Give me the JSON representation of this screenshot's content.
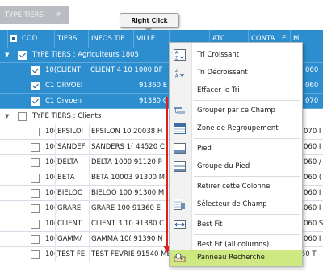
{
  "group_panel": {
    "chip_label": "TYPE TIERS",
    "filter_icon": "filter-icon"
  },
  "tooltip": {
    "label": "Right Click"
  },
  "columns": [
    "COD",
    "TIERS",
    "INFOS.TIE",
    "VILLE",
    "",
    "ATC",
    "CONTA",
    "EL",
    "M"
  ],
  "groups": [
    {
      "title": "TYPE TIERS : Agriculteurs 1805",
      "selected": true,
      "rows": [
        {
          "cod": "10(",
          "tiers": "CLIENT",
          "infos": "CLIENT 4 10 1000 BF",
          "tail": "060"
        },
        {
          "cod": "C1",
          "tiers": "ORVOEI",
          "infos": "91360 E",
          "tail": "060"
        },
        {
          "cod": "C1",
          "tiers": "Orvoen",
          "infos": "91380 C",
          "tail": "070"
        }
      ]
    },
    {
      "title": "TYPE TIERS : Clients",
      "selected": false,
      "rows": [
        {
          "cod": "10(",
          "tiers": "EPSILOI",
          "infos": "EPSILON 10 20038 H",
          "tail": "070 I"
        },
        {
          "cod": "10(",
          "tiers": "SANDEF",
          "infos": "SANDERS 1( 44520 C",
          "tail": "060 I"
        },
        {
          "cod": "10(",
          "tiers": "DELTA",
          "infos": "DELTA 1000 91120 P",
          "tail": "060 /"
        },
        {
          "cod": "10(",
          "tiers": "BETA",
          "infos": "BETA 10003 91300 M",
          "tail": "060 ("
        },
        {
          "cod": "10(",
          "tiers": "BIELOO",
          "infos": "BIELOO 100 91300 M",
          "tail": "060 I"
        },
        {
          "cod": "10(",
          "tiers": "GRARE",
          "infos": "GRARE 100 91360 E",
          "tail": "060 I"
        },
        {
          "cod": "10(",
          "tiers": "CLIENT",
          "infos": "CLIENT 3 10 91380 C",
          "tail": "060 S"
        },
        {
          "cod": "10(",
          "tiers": "GAMM/",
          "infos": "GAMMA 10( 91390 N",
          "tail": "060 I"
        },
        {
          "cod": "10(",
          "tiers": "TEST FE",
          "infos": "TEST FEVRIE 91540 MENNECY ATC SITE",
          "tail": "TOTO 020 060 T"
        }
      ]
    }
  ],
  "context_menu": {
    "items": [
      {
        "label": "Tri Croissant",
        "icon": "sort-ascending-icon"
      },
      {
        "label": "Tri Décroissant",
        "icon": "sort-descending-icon"
      },
      {
        "label": "Effacer le Tri",
        "icon": ""
      },
      {
        "label": "Grouper par ce Champ",
        "icon": "group-by-field-icon"
      },
      {
        "label": "Zone de Regroupement",
        "icon": "group-panel-icon"
      },
      {
        "label": "Pied",
        "icon": "footer-icon"
      },
      {
        "label": "Groupe du Pied",
        "icon": "group-footer-icon"
      },
      {
        "label": "Retirer cette Colonne",
        "icon": ""
      },
      {
        "label": "Sélecteur de Champ",
        "icon": "column-chooser-icon"
      },
      {
        "label": "Best Fit",
        "icon": "best-fit-icon"
      },
      {
        "label": "Best Fit (all columns)",
        "icon": ""
      },
      {
        "label": "Panneau Recherche",
        "icon": "find-panel-icon"
      }
    ],
    "highlighted": "Panneau Recherche"
  },
  "colors": {
    "header": "#2c8ecf",
    "highlight": "#cfe982",
    "arrow": "#e0201a"
  }
}
